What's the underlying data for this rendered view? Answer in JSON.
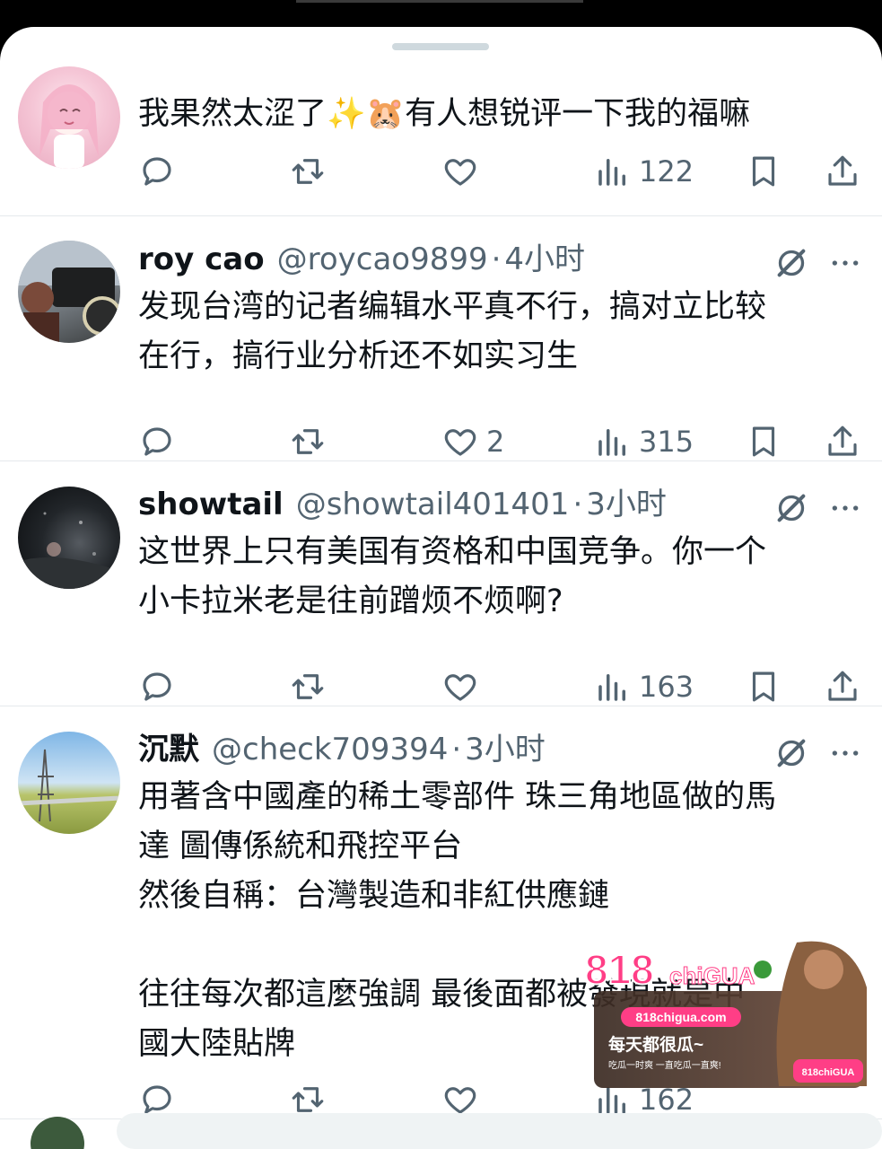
{
  "tweets": [
    {
      "name": "",
      "handle": "",
      "time": "",
      "lines": [
        "我果然太涩了✨🐹有人想锐评一下我的福嘛"
      ],
      "reply_count": "",
      "like_count": "",
      "views": "122"
    },
    {
      "name": "roy cao",
      "handle": "@roycao9899",
      "time": "4小时",
      "lines": [
        "发现台湾的记者编辑水平真不行，搞对立比较",
        "在行，搞行业分析还不如实习生"
      ],
      "like_count": "2",
      "views": "315"
    },
    {
      "name": "showtail",
      "handle": "@showtail401401",
      "time": "3小时",
      "lines": [
        "这世界上只有美国有资格和中国竞争。你一个",
        "小卡拉米老是往前蹭烦不烦啊?"
      ],
      "like_count": "",
      "views": "163"
    },
    {
      "name": "沉默",
      "handle": "@check709394",
      "time": "3小时",
      "lines": [
        "用著含中國產的稀土零部件 珠三角地區做的馬",
        "達 圖傳係統和飛控平台",
        "然後自稱：台灣製造和非紅供應鏈",
        "",
        "往往每次都這麼強調 最後面都被發現就是中",
        "國大陸貼牌"
      ],
      "like_count": "",
      "views": "162"
    }
  ],
  "separator": "·",
  "ad": {
    "logo": "818chiGUA",
    "url": "818chigua.com",
    "slogan": "每天都很瓜~",
    "sub": "吃瓜一时爽 一直吃瓜一直爽!",
    "badge": "818chiGUA"
  },
  "colors": {
    "text": "#0f1419",
    "muted": "#536471",
    "divider": "#e5e9ec"
  },
  "icons": [
    "reply-icon",
    "retweet-icon",
    "like-icon",
    "views-icon",
    "bookmark-icon",
    "share-icon",
    "grok-icon",
    "more-icon"
  ]
}
